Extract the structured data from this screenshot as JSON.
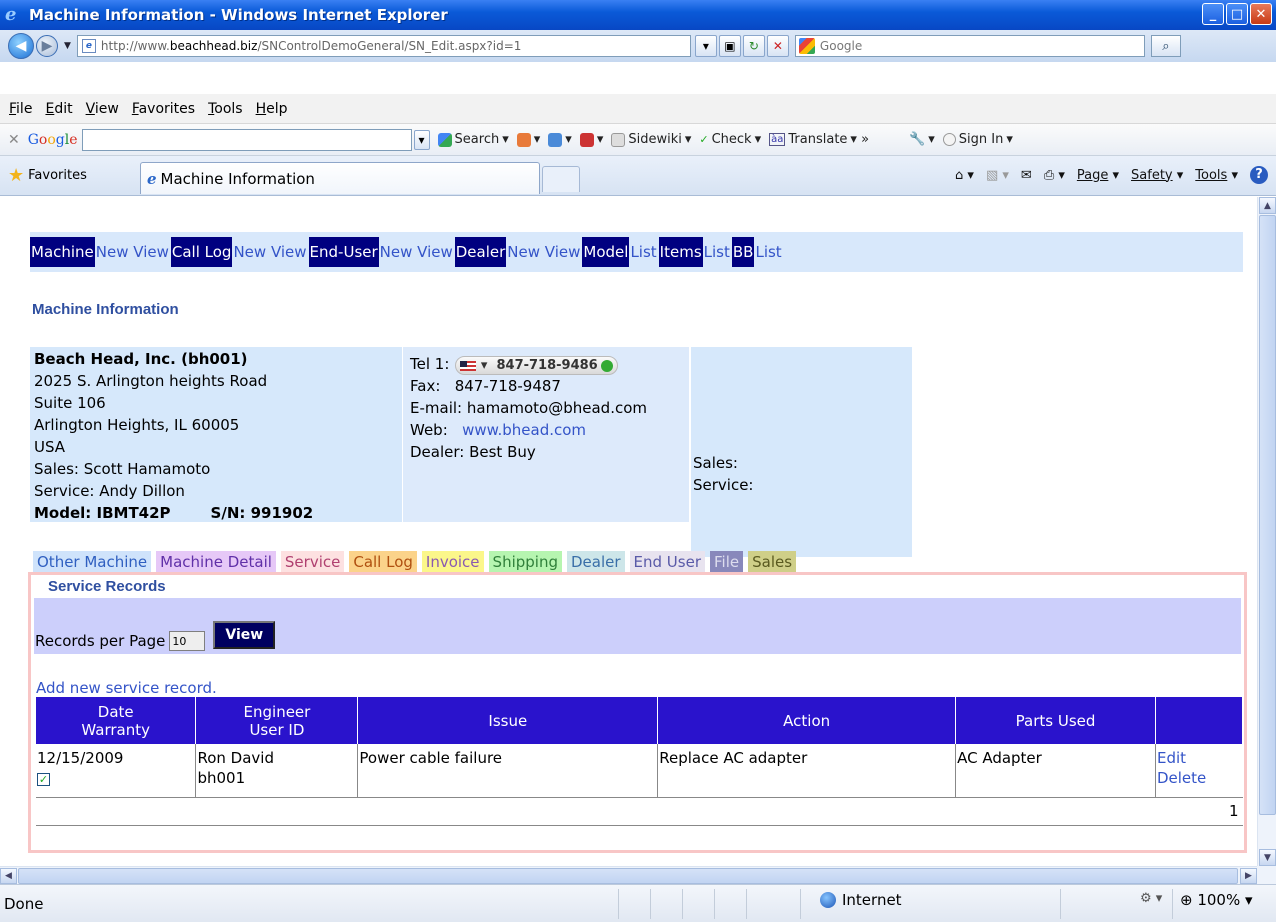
{
  "window": {
    "title": "Machine Information - Windows Internet Explorer"
  },
  "address": {
    "url_prefix": "http://www.",
    "url_domain": "beachhead.biz",
    "url_path": "/SNControlDemoGeneral/SN_Edit.aspx?id=1",
    "search_placeholder": "Google"
  },
  "menu": [
    "File",
    "Edit",
    "View",
    "Favorites",
    "Tools",
    "Help"
  ],
  "google_toolbar": {
    "logo": "Google",
    "items": [
      "Search",
      "Sidewiki",
      "Check",
      "Translate",
      "Sign In"
    ]
  },
  "favorites": {
    "label": "Favorites",
    "tab_title": "Machine Information",
    "commands": [
      "Page",
      "Safety",
      "Tools"
    ]
  },
  "page_nav": [
    {
      "label": "Machine",
      "style": "dark"
    },
    {
      "label": "New View",
      "style": "link"
    },
    {
      "label": "Call Log",
      "style": "dark"
    },
    {
      "label": "New View",
      "style": "link"
    },
    {
      "label": "End-User",
      "style": "dark"
    },
    {
      "label": "New View",
      "style": "link"
    },
    {
      "label": "Dealer",
      "style": "dark"
    },
    {
      "label": "New View",
      "style": "link"
    },
    {
      "label": "Model",
      "style": "dark"
    },
    {
      "label": "List",
      "style": "link"
    },
    {
      "label": "Items",
      "style": "dark"
    },
    {
      "label": "List",
      "style": "link"
    },
    {
      "label": "BB",
      "style": "dark"
    },
    {
      "label": "List",
      "style": "link"
    }
  ],
  "section_title": "Machine Information",
  "customer": {
    "name": "Beach Head, Inc. (bh001)",
    "address1": "2025 S. Arlington heights Road",
    "address2": "Suite 106",
    "city": "Arlington Heights, IL 60005",
    "country": "USA",
    "sales": "Sales: Scott Hamamoto",
    "service": "Service: Andy Dillon",
    "model": "Model: IBMT42P",
    "sn": "S/N: 991902"
  },
  "contact": {
    "tel_label": "Tel 1:",
    "tel": "847-718-9486",
    "fax_label": "Fax:",
    "fax": "847-718-9487",
    "email_label": "E-mail:",
    "email": "hamamoto@bhead.com",
    "web_label": "Web:",
    "web": "www.bhead.com",
    "dealer": "Dealer: Best Buy"
  },
  "dealer_box": {
    "sales": "Sales:",
    "service": "Service:"
  },
  "tabs": [
    {
      "label": "Other Machine",
      "bg": "#cfe3fb",
      "fg": "#2f5fc0"
    },
    {
      "label": "Machine Detail",
      "bg": "#e6c8f7",
      "fg": "#6030a8"
    },
    {
      "label": "Service",
      "bg": "#fde1e1",
      "fg": "#b04070"
    },
    {
      "label": "Call Log",
      "bg": "#fbd38a",
      "fg": "#b05010"
    },
    {
      "label": "Invoice",
      "bg": "#fbf78a",
      "fg": "#8a5ab0"
    },
    {
      "label": "Shipping",
      "bg": "#b6f5b0",
      "fg": "#30803a"
    },
    {
      "label": "Dealer",
      "bg": "#cde6e9",
      "fg": "#3a6fa8"
    },
    {
      "label": "End User",
      "bg": "#e8e3ef",
      "fg": "#5a5aa8"
    },
    {
      "label": "File",
      "bg": "#8888bb",
      "fg": "#dde"
    },
    {
      "label": "Sales",
      "bg": "#cfcf88",
      "fg": "#5a5a20"
    }
  ],
  "service": {
    "title": "Service Records",
    "records_label": "Records per Page",
    "records_value": "10",
    "view_button": "View",
    "add_link": "Add new service record.",
    "columns": [
      "Date Warranty",
      "Engineer User ID",
      "Issue",
      "Action",
      "Parts Used",
      ""
    ],
    "rows": [
      {
        "date": "12/15/2009",
        "warranty": true,
        "engineer": "Ron David",
        "user_id": "bh001",
        "issue": "Power cable failure",
        "action": "Replace AC adapter",
        "parts": "AC Adapter",
        "edit": "Edit",
        "delete": "Delete"
      }
    ],
    "pager": "1"
  },
  "status": {
    "text": "Done",
    "zone": "Internet",
    "zoom": "100%"
  }
}
